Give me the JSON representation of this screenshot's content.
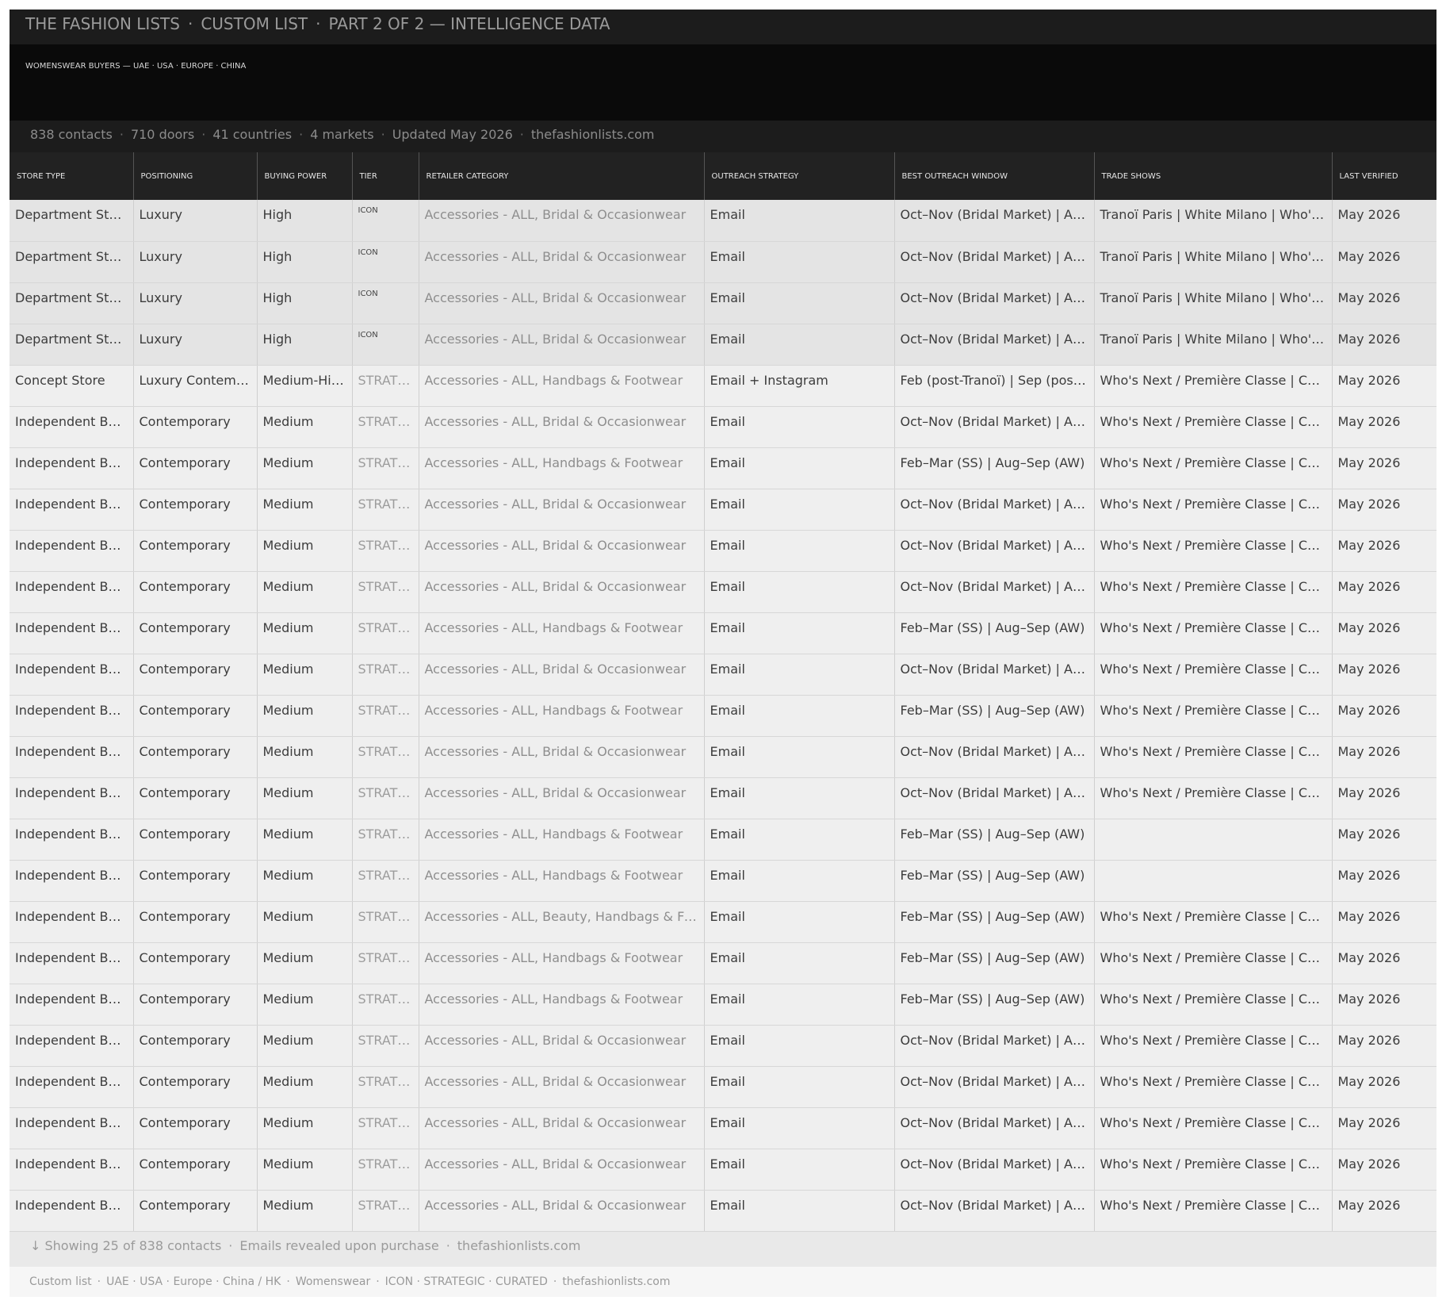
{
  "header": {
    "brand": "THE FASHION LISTS",
    "list_type": "CUSTOM LIST",
    "part": "PART 2 OF 2 — INTELLIGENCE DATA",
    "separator": "·"
  },
  "hero": {
    "subtitle": "WOMENSWEAR BUYERS — UAE · USA · EUROPE · CHINA"
  },
  "stats": {
    "contacts": "838 contacts",
    "doors": "710 doors",
    "countries": "41 countries",
    "markets": "4 markets",
    "updated": "Updated May 2026",
    "site": "thefashionlists.com"
  },
  "table": {
    "columns": [
      "STORE TYPE",
      "POSITIONING",
      "BUYING POWER",
      "TIER",
      "RETAILER CATEGORY",
      "OUTREACH STRATEGY",
      "BEST OUTREACH WINDOW",
      "TRADE SHOWS",
      "LAST VERIFIED"
    ],
    "rows": [
      {
        "store_type": "Department Store",
        "positioning": "Luxury",
        "buying_power": "High",
        "tier": "ICON",
        "category": "Accessories - ALL, Bridal & Occasionwear",
        "outreach": "Email",
        "window": "Oct–Nov (Bridal Market) | Aug–Sep (AW)",
        "trade_shows": "Tranoï Paris | White Milano | Who's Next",
        "verified": "May 2026",
        "style": "hl"
      },
      {
        "store_type": "Department Store",
        "positioning": "Luxury",
        "buying_power": "High",
        "tier": "ICON",
        "category": "Accessories - ALL, Bridal & Occasionwear",
        "outreach": "Email",
        "window": "Oct–Nov (Bridal Market) | Aug–Sep (AW)",
        "trade_shows": "Tranoï Paris | White Milano | Who's Next",
        "verified": "May 2026",
        "style": "hl"
      },
      {
        "store_type": "Department Store",
        "positioning": "Luxury",
        "buying_power": "High",
        "tier": "ICON",
        "category": "Accessories - ALL, Bridal & Occasionwear",
        "outreach": "Email",
        "window": "Oct–Nov (Bridal Market) | Aug–Sep (AW)",
        "trade_shows": "Tranoï Paris | White Milano | Who's Next",
        "verified": "May 2026",
        "style": "hl"
      },
      {
        "store_type": "Department Store",
        "positioning": "Luxury",
        "buying_power": "High",
        "tier": "ICON",
        "category": "Accessories - ALL, Bridal & Occasionwear",
        "outreach": "Email",
        "window": "Oct–Nov (Bridal Market) | Aug–Sep (AW)",
        "trade_shows": "Tranoï Paris | White Milano | Who's Next",
        "verified": "May 2026",
        "style": "hl"
      },
      {
        "store_type": "Concept Store",
        "positioning": "Luxury Contemporary",
        "buying_power": "Medium-High",
        "tier": "STRATEGIC",
        "category": "Accessories - ALL, Handbags & Footwear",
        "outreach": "Email + Instagram",
        "window": "Feb (post-Tranoï) | Sep (post-Tranoï)",
        "trade_shows": "Who's Next / Première Classe | Coterie",
        "verified": "May 2026",
        "style": "std"
      },
      {
        "store_type": "Independent Boutique",
        "positioning": "Contemporary",
        "buying_power": "Medium",
        "tier": "STRATEGIC",
        "category": "Accessories - ALL, Bridal & Occasionwear",
        "outreach": "Email",
        "window": "Oct–Nov (Bridal Market) | Aug–Sep (AW)",
        "trade_shows": "Who's Next / Première Classe | Coterie",
        "verified": "May 2026",
        "style": "std"
      },
      {
        "store_type": "Independent Boutique",
        "positioning": "Contemporary",
        "buying_power": "Medium",
        "tier": "STRATEGIC",
        "category": "Accessories - ALL, Handbags & Footwear",
        "outreach": "Email",
        "window": "Feb–Mar (SS) | Aug–Sep (AW)",
        "trade_shows": "Who's Next / Première Classe | Coterie",
        "verified": "May 2026",
        "style": "std"
      },
      {
        "store_type": "Independent Boutique",
        "positioning": "Contemporary",
        "buying_power": "Medium",
        "tier": "STRATEGIC",
        "category": "Accessories - ALL, Bridal & Occasionwear",
        "outreach": "Email",
        "window": "Oct–Nov (Bridal Market) | Aug–Sep (AW)",
        "trade_shows": "Who's Next / Première Classe | Coterie",
        "verified": "May 2026",
        "style": "std"
      },
      {
        "store_type": "Independent Boutique",
        "positioning": "Contemporary",
        "buying_power": "Medium",
        "tier": "STRATEGIC",
        "category": "Accessories - ALL, Bridal & Occasionwear",
        "outreach": "Email",
        "window": "Oct–Nov (Bridal Market) | Aug–Sep (AW)",
        "trade_shows": "Who's Next / Première Classe | Coterie",
        "verified": "May 2026",
        "style": "std"
      },
      {
        "store_type": "Independent Boutique",
        "positioning": "Contemporary",
        "buying_power": "Medium",
        "tier": "STRATEGIC",
        "category": "Accessories - ALL, Bridal & Occasionwear",
        "outreach": "Email",
        "window": "Oct–Nov (Bridal Market) | Aug–Sep (AW)",
        "trade_shows": "Who's Next / Première Classe | Coterie",
        "verified": "May 2026",
        "style": "std"
      },
      {
        "store_type": "Independent Boutique",
        "positioning": "Contemporary",
        "buying_power": "Medium",
        "tier": "STRATEGIC",
        "category": "Accessories - ALL, Handbags & Footwear",
        "outreach": "Email",
        "window": "Feb–Mar (SS) | Aug–Sep (AW)",
        "trade_shows": "Who's Next / Première Classe | Coterie",
        "verified": "May 2026",
        "style": "std"
      },
      {
        "store_type": "Independent Boutique",
        "positioning": "Contemporary",
        "buying_power": "Medium",
        "tier": "STRATEGIC",
        "category": "Accessories - ALL, Bridal & Occasionwear",
        "outreach": "Email",
        "window": "Oct–Nov (Bridal Market) | Aug–Sep (AW)",
        "trade_shows": "Who's Next / Première Classe | Coterie",
        "verified": "May 2026",
        "style": "std"
      },
      {
        "store_type": "Independent Boutique",
        "positioning": "Contemporary",
        "buying_power": "Medium",
        "tier": "STRATEGIC",
        "category": "Accessories - ALL, Handbags & Footwear",
        "outreach": "Email",
        "window": "Feb–Mar (SS) | Aug–Sep (AW)",
        "trade_shows": "Who's Next / Première Classe | Coterie",
        "verified": "May 2026",
        "style": "std"
      },
      {
        "store_type": "Independent Boutique",
        "positioning": "Contemporary",
        "buying_power": "Medium",
        "tier": "STRATEGIC",
        "category": "Accessories - ALL, Bridal & Occasionwear",
        "outreach": "Email",
        "window": "Oct–Nov (Bridal Market) | Aug–Sep (AW)",
        "trade_shows": "Who's Next / Première Classe | Coterie",
        "verified": "May 2026",
        "style": "std"
      },
      {
        "store_type": "Independent Boutique",
        "positioning": "Contemporary",
        "buying_power": "Medium",
        "tier": "STRATEGIC",
        "category": "Accessories - ALL, Bridal & Occasionwear",
        "outreach": "Email",
        "window": "Oct–Nov (Bridal Market) | Aug–Sep (AW)",
        "trade_shows": "Who's Next / Première Classe | Coterie",
        "verified": "May 2026",
        "style": "std"
      },
      {
        "store_type": "Independent Boutique",
        "positioning": "Contemporary",
        "buying_power": "Medium",
        "tier": "STRATEGIC",
        "category": "Accessories - ALL, Handbags & Footwear",
        "outreach": "Email",
        "window": "Feb–Mar (SS) | Aug–Sep (AW)",
        "trade_shows": "",
        "verified": "May 2026",
        "style": "std"
      },
      {
        "store_type": "Independent Boutique",
        "positioning": "Contemporary",
        "buying_power": "Medium",
        "tier": "STRATEGIC",
        "category": "Accessories - ALL, Handbags & Footwear",
        "outreach": "Email",
        "window": "Feb–Mar (SS) | Aug–Sep (AW)",
        "trade_shows": "",
        "verified": "May 2026",
        "style": "std"
      },
      {
        "store_type": "Independent Boutique",
        "positioning": "Contemporary",
        "buying_power": "Medium",
        "tier": "STRATEGIC",
        "category": "Accessories - ALL, Beauty, Handbags & Footwear",
        "outreach": "Email",
        "window": "Feb–Mar (SS) | Aug–Sep (AW)",
        "trade_shows": "Who's Next / Première Classe | Coterie",
        "verified": "May 2026",
        "style": "std"
      },
      {
        "store_type": "Independent Boutique",
        "positioning": "Contemporary",
        "buying_power": "Medium",
        "tier": "STRATEGIC",
        "category": "Accessories - ALL, Handbags & Footwear",
        "outreach": "Email",
        "window": "Feb–Mar (SS) | Aug–Sep (AW)",
        "trade_shows": "Who's Next / Première Classe | Coterie",
        "verified": "May 2026",
        "style": "std"
      },
      {
        "store_type": "Independent Boutique",
        "positioning": "Contemporary",
        "buying_power": "Medium",
        "tier": "STRATEGIC",
        "category": "Accessories - ALL, Handbags & Footwear",
        "outreach": "Email",
        "window": "Feb–Mar (SS) | Aug–Sep (AW)",
        "trade_shows": "Who's Next / Première Classe | Coterie",
        "verified": "May 2026",
        "style": "std"
      },
      {
        "store_type": "Independent Boutique",
        "positioning": "Contemporary",
        "buying_power": "Medium",
        "tier": "STRATEGIC",
        "category": "Accessories - ALL, Bridal & Occasionwear",
        "outreach": "Email",
        "window": "Oct–Nov (Bridal Market) | Aug–Sep (AW)",
        "trade_shows": "Who's Next / Première Classe | Coterie",
        "verified": "May 2026",
        "style": "std"
      },
      {
        "store_type": "Independent Boutique",
        "positioning": "Contemporary",
        "buying_power": "Medium",
        "tier": "STRATEGIC",
        "category": "Accessories - ALL, Bridal & Occasionwear",
        "outreach": "Email",
        "window": "Oct–Nov (Bridal Market) | Aug–Sep (AW)",
        "trade_shows": "Who's Next / Première Classe | Coterie",
        "verified": "May 2026",
        "style": "std"
      },
      {
        "store_type": "Independent Boutique",
        "positioning": "Contemporary",
        "buying_power": "Medium",
        "tier": "STRATEGIC",
        "category": "Accessories - ALL, Bridal & Occasionwear",
        "outreach": "Email",
        "window": "Oct–Nov (Bridal Market) | Aug–Sep (AW)",
        "trade_shows": "Who's Next / Première Classe | Coterie",
        "verified": "May 2026",
        "style": "std"
      },
      {
        "store_type": "Independent Boutique",
        "positioning": "Contemporary",
        "buying_power": "Medium",
        "tier": "STRATEGIC",
        "category": "Accessories - ALL, Bridal & Occasionwear",
        "outreach": "Email",
        "window": "Oct–Nov (Bridal Market) | Aug–Sep (AW)",
        "trade_shows": "Who's Next / Première Classe | Coterie",
        "verified": "May 2026",
        "style": "std"
      },
      {
        "store_type": "Independent Boutique",
        "positioning": "Contemporary",
        "buying_power": "Medium",
        "tier": "STRATEGIC",
        "category": "Accessories - ALL, Bridal & Occasionwear",
        "outreach": "Email",
        "window": "Oct–Nov (Bridal Market) | Aug–Sep (AW)",
        "trade_shows": "Who's Next / Première Classe | Coterie",
        "verified": "May 2026",
        "style": "std"
      }
    ]
  },
  "footer": {
    "arrow": "↓",
    "showing": "Showing 25 of 838 contacts",
    "emails_note": "Emails revealed upon purchase",
    "site": "thefashionlists.com"
  },
  "bottom": {
    "list": "Custom list",
    "regions": "UAE · USA · Europe · China / HK",
    "segment": "Womenswear",
    "tiers": "ICON · STRATEGIC · CURATED",
    "site": "thefashionlists.com"
  }
}
